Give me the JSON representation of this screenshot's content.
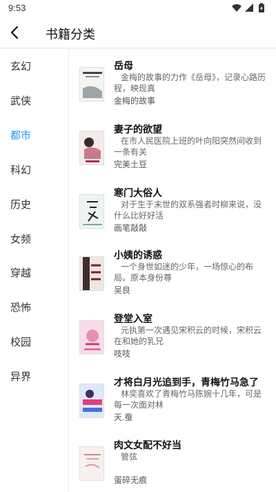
{
  "status_bar": {
    "time": "9:53",
    "icons": [
      "wifi-icon",
      "signal-icon",
      "battery-icon"
    ]
  },
  "app_bar": {
    "title": "书籍分类",
    "back_icon": "back-arrow-icon"
  },
  "sidebar": {
    "active_index": 2,
    "active_color": "#2196f3",
    "items": [
      {
        "label": "玄幻"
      },
      {
        "label": "武侠"
      },
      {
        "label": "都市"
      },
      {
        "label": "科幻"
      },
      {
        "label": "历史"
      },
      {
        "label": "女频"
      },
      {
        "label": "穿越"
      },
      {
        "label": "恐怖"
      },
      {
        "label": "校园"
      },
      {
        "label": "异界"
      }
    ]
  },
  "books": [
    {
      "title": "岳母",
      "desc": "金梅的故事的力作《岳母》，记录心路历程，映现真",
      "author": "金梅的故事"
    },
    {
      "title": "妻子的欲望",
      "desc": "在市人民医院上班的叶向阳突然间收到一条有关",
      "author": "完美土豆"
    },
    {
      "title": "寒门大俗人",
      "desc": "对于生于末世的双系强者时柳来说，没什么比好好活",
      "author": "画笔敲敲"
    },
    {
      "title": "小姨的诱惑",
      "desc": "一个身世如迷的少年，一场惊心的布局。原本身份尊",
      "author": "吴良"
    },
    {
      "title": "登堂入室",
      "desc": "元执第一次遇见宋积云的时候，宋积云在和她的乳兄",
      "author": "吱吱"
    },
    {
      "title": "才将白月光追到手，青梅竹马急了",
      "desc": "林奕喜欢了青梅竹马陈婉十几年，可是每一次面对林",
      "author": "天.蚕"
    },
    {
      "title": "肉文女配不好当",
      "desc": "管弦",
      "author": "蛋碎无痕"
    }
  ]
}
